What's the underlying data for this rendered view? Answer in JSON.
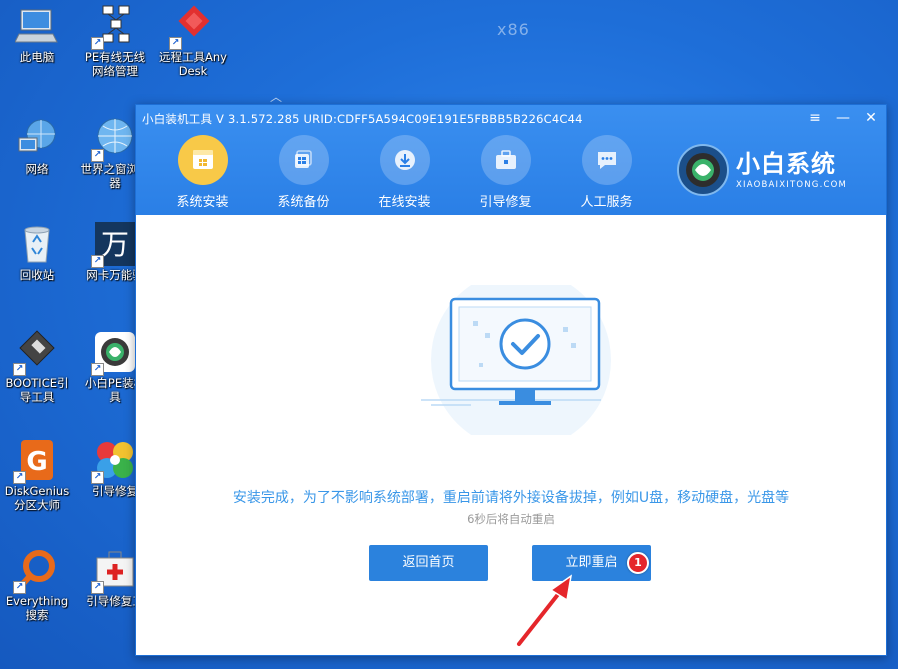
{
  "desktop": {
    "watermark": "x86",
    "icons": [
      {
        "label": "此电脑"
      },
      {
        "label": "PE有线无线网络管理"
      },
      {
        "label": "远程工具AnyDesk"
      },
      {
        "label": "网络"
      },
      {
        "label": "世界之窗浏览器"
      },
      {
        "label": "回收站"
      },
      {
        "label": "网卡万能驱"
      },
      {
        "label": "BOOTICE引导工具"
      },
      {
        "label": "小白PE装机具"
      },
      {
        "label": "DiskGenius分区大师"
      },
      {
        "label": "引导修复"
      },
      {
        "label": "Everything搜索"
      },
      {
        "label": "引导修复工"
      }
    ]
  },
  "window": {
    "title": "小白装机工具 V 3.1.572.285 URID:CDFF5A594C09E191E5FBBB5B226C4C44",
    "nav": [
      {
        "label": "系统安装",
        "icon": "windows-box-icon",
        "active": true
      },
      {
        "label": "系统备份",
        "icon": "windows-backup-icon",
        "active": false
      },
      {
        "label": "在线安装",
        "icon": "download-icon",
        "active": false
      },
      {
        "label": "引导修复",
        "icon": "toolbox-icon",
        "active": false
      },
      {
        "label": "人工服务",
        "icon": "chat-icon",
        "active": false
      }
    ],
    "brand": {
      "name": "小白系统",
      "sub": "XIAOBAIXITONG.COM"
    },
    "content": {
      "message": "安装完成，为了不影响系统部署，重启前请将外接设备拔掉，例如U盘，移动硬盘，光盘等",
      "countdown": "6秒后将自动重启",
      "back_button": "返回首页",
      "reboot_button": "立即重启",
      "badge": "1"
    }
  },
  "colors": {
    "accent": "#2b82dd",
    "header": "#3a8ff0",
    "active_nav": "#f8c948",
    "message": "#3a97e8",
    "badge": "#e5262b"
  }
}
